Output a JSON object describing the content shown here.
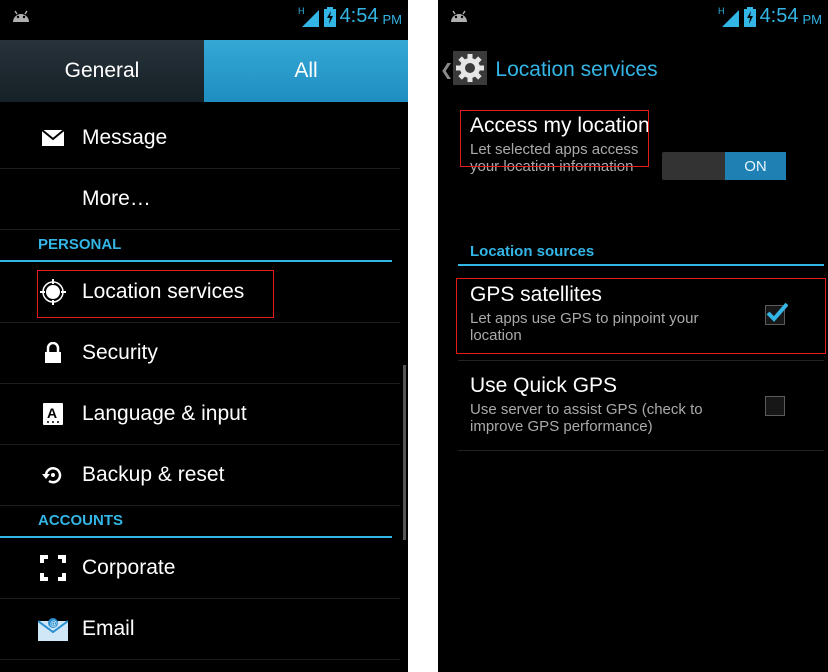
{
  "left": {
    "status": {
      "network": "H",
      "time": "4:54",
      "ampm": "PM"
    },
    "tabs": [
      {
        "label": "General"
      },
      {
        "label": "All"
      }
    ],
    "items_top": [
      {
        "label": "Message",
        "icon": "envelope-icon"
      },
      {
        "label": "More…"
      }
    ],
    "section_personal": "PERSONAL",
    "items_personal": [
      {
        "label": "Location services",
        "icon": "location-target-icon"
      },
      {
        "label": "Security",
        "icon": "lock-icon"
      },
      {
        "label": "Language & input",
        "icon": "keyboard-a-icon"
      },
      {
        "label": "Backup & reset",
        "icon": "backup-restore-icon"
      }
    ],
    "section_accounts": "ACCOUNTS",
    "items_accounts": [
      {
        "label": "Corporate",
        "icon": "corporate-brackets-icon"
      },
      {
        "label": "Email",
        "icon": "email-envelope-icon"
      }
    ]
  },
  "right": {
    "status": {
      "network": "H",
      "time": "4:54",
      "ampm": "PM"
    },
    "title": "Location services",
    "access": {
      "title": "Access my location",
      "summary": "Let selected apps access your location information",
      "toggle": "ON"
    },
    "section": "Location sources",
    "gps": {
      "title": "GPS satellites",
      "summary": "Let apps use GPS to pinpoint your location",
      "checked": true
    },
    "quick_gps": {
      "title": "Use Quick GPS",
      "summary": "Use server to assist GPS (check to improve GPS performance)",
      "checked": false
    }
  },
  "colors": {
    "accent": "#33b5e5",
    "highlight": "#e21b1b",
    "background": "#000000"
  }
}
